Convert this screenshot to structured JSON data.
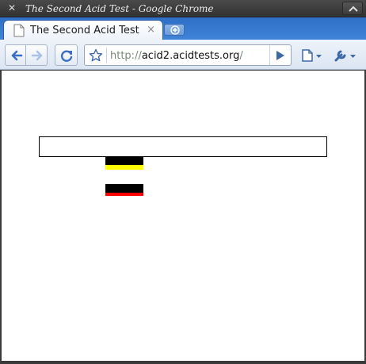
{
  "window": {
    "close_glyph": "✕",
    "title": "The Second Acid Test - Google Chrome"
  },
  "tabs": [
    {
      "title": "The Second Acid Test",
      "close_glyph": "×",
      "active": true
    }
  ],
  "toolbar": {
    "address": {
      "scheme": "http://",
      "host": "acid2.acidtests.org",
      "path": "/"
    },
    "icons": [
      "back-icon",
      "forward-icon",
      "reload-icon",
      "star-icon",
      "go-icon",
      "page-menu-icon",
      "wrench-icon"
    ]
  },
  "page": {
    "render_colors": {
      "outline": "#000000",
      "bar_black": "#000000",
      "bar_yellow": "#ffff00",
      "bar_red": "#ff0000"
    }
  },
  "theme": {
    "tabstrip": "#3e84d8",
    "titlebar": "#3a3a3a",
    "toolbar": "#dbe5f2"
  }
}
